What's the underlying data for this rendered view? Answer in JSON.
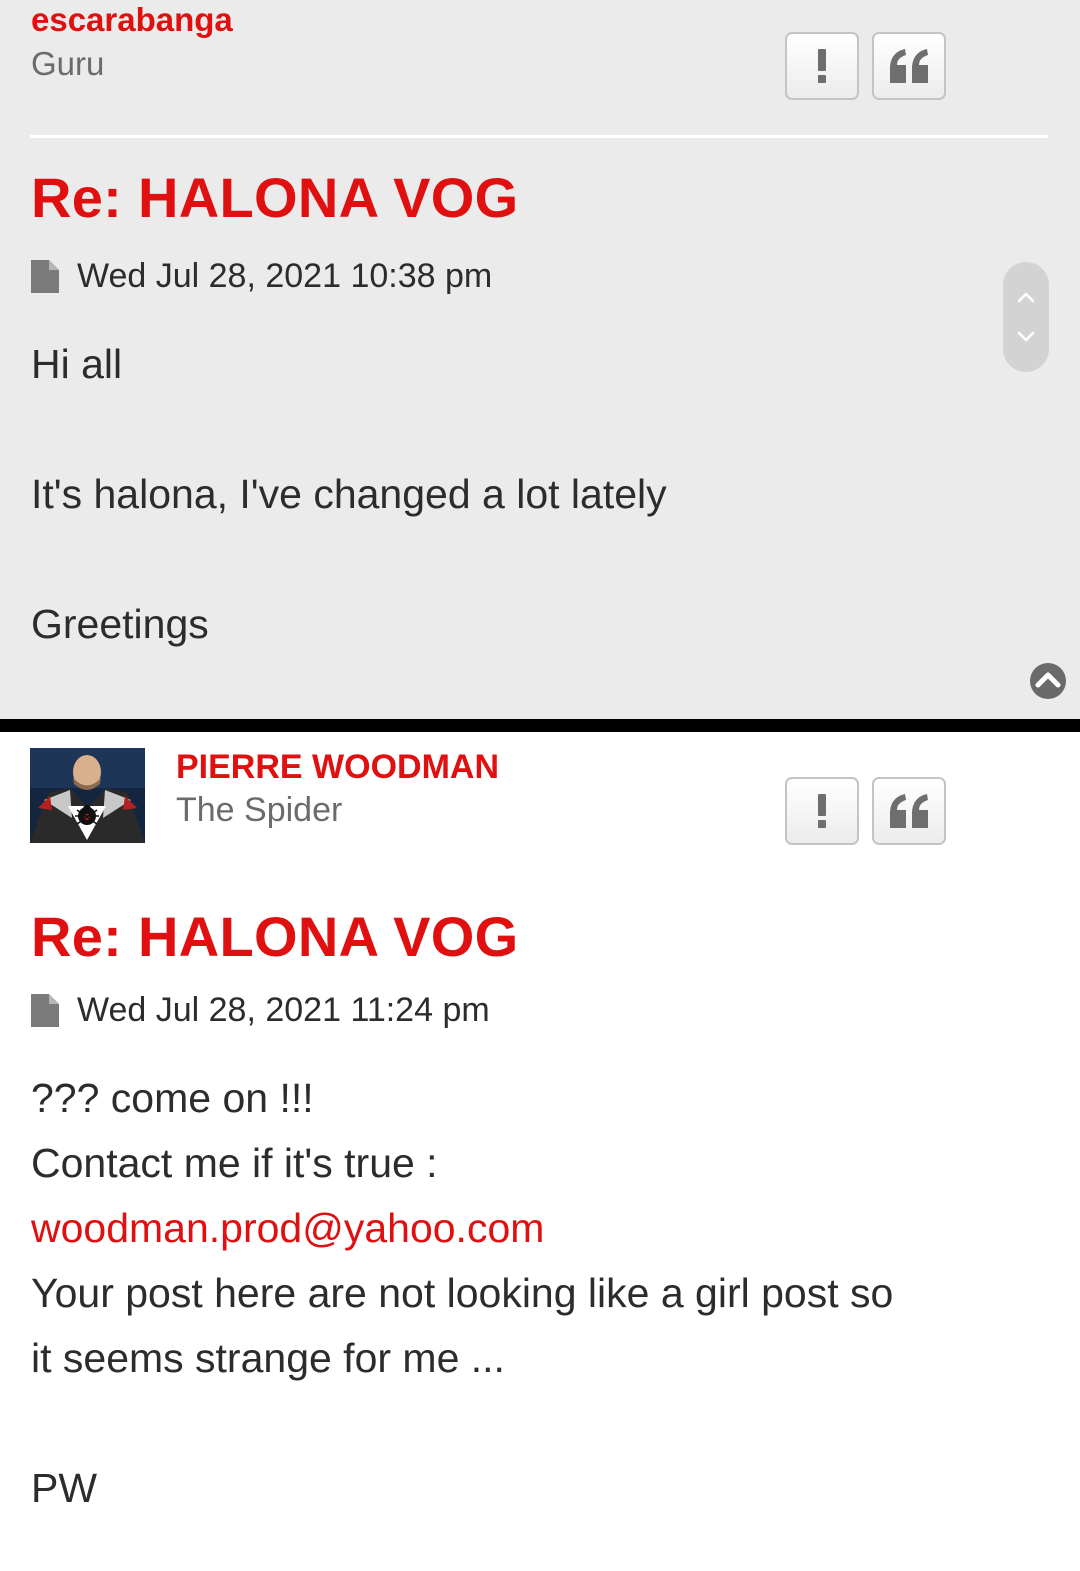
{
  "posts": [
    {
      "username": "escarabanga",
      "rank": "Guru",
      "title": "Re: HALONA VOG",
      "date": "Wed Jul 28, 2021 10:38 pm",
      "lines": [
        "Hi all",
        "It's halona, I've changed a lot lately",
        "Greetings"
      ]
    },
    {
      "username": "PIERRE WOODMAN",
      "rank": "The Spider",
      "title": "Re: HALONA VOG",
      "date": "Wed Jul 28, 2021 11:24 pm",
      "line1": "??? come on !!!",
      "line2": "Contact me if it's true :",
      "email": "woodman.prod@yahoo.com",
      "line3": "Your post here are not looking like a girl post so",
      "line4": "it seems strange for me ...",
      "signature": "PW"
    }
  ],
  "buttons": {
    "report_icon": "exclamation-icon",
    "quote_icon": "quote-icon"
  },
  "colors": {
    "accent": "#e01010",
    "post_bg_alt": "#ebebeb"
  }
}
